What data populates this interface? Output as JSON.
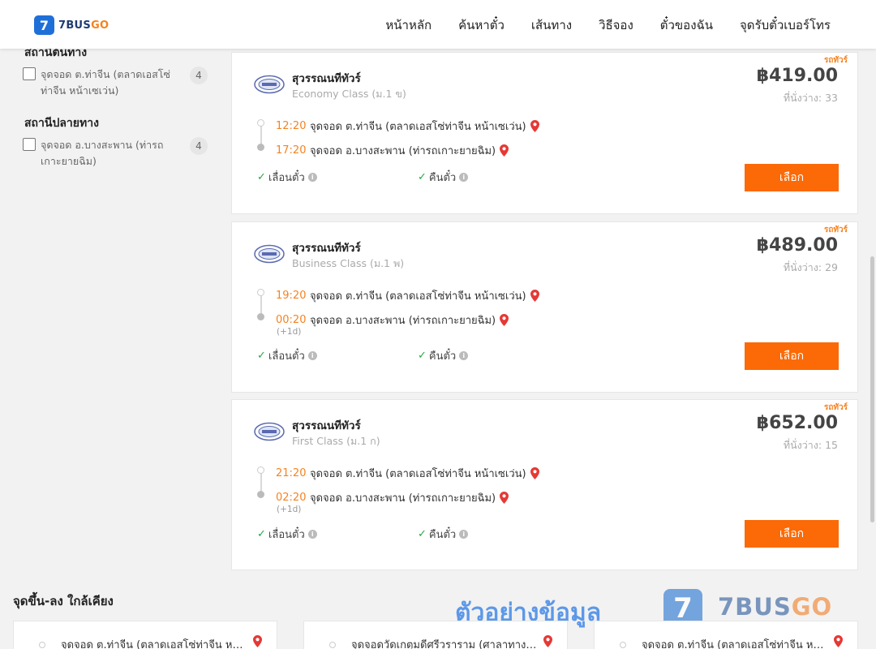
{
  "header": {
    "logo_mark": "7",
    "logo_text_a": "7BUS",
    "logo_text_b": "GO",
    "nav": [
      "หน้าหลัก",
      "ค้นหาตั๋ว",
      "เส้นทาง",
      "วิธีจอง",
      "ตั๋วของฉัน",
      "จุดรับตั๋วเบอร์โทร"
    ]
  },
  "filters": {
    "origin_title": "สถานีต้นทาง",
    "origin_item": {
      "label": "จุดจอด ต.ท่าจีน (ตลาดเอสโซ่ท่าจีน หน้าเซเว่น)",
      "count": "4"
    },
    "dest_title": "สถานีปลายทาง",
    "dest_item": {
      "label": "จุดจอด อ.บางสะพาน (ท่ารถเกาะยายฉิม)",
      "count": "4"
    }
  },
  "trips": [
    {
      "tag": "รถทัวร์",
      "operator": "สุวรรณนทีทัวร์",
      "class": "Economy Class (ม.1 ข)",
      "price": "฿419.00",
      "seats": "ที่นั่งว่าง: 33",
      "depart_time": "12:20",
      "depart_stop": "จุดจอด ต.ท่าจีน (ตลาดเอสโซ่ท่าจีน หน้าเซเว่น)",
      "arrive_time": "17:20",
      "arrive_stop": "จุดจอด อ.บางสะพาน (ท่ารถเกาะยายฉิม)",
      "next_day": "",
      "feature_1": "เลื่อนตั๋ว",
      "feature_2": "คืนตั๋ว",
      "button": "เลือก"
    },
    {
      "tag": "รถทัวร์",
      "operator": "สุวรรณนทีทัวร์",
      "class": "Business Class (ม.1 พ)",
      "price": "฿489.00",
      "seats": "ที่นั่งว่าง: 29",
      "depart_time": "19:20",
      "depart_stop": "จุดจอด ต.ท่าจีน (ตลาดเอสโซ่ท่าจีน หน้าเซเว่น)",
      "arrive_time": "00:20",
      "arrive_stop": "จุดจอด อ.บางสะพาน (ท่ารถเกาะยายฉิม)",
      "next_day": "(+1d)",
      "feature_1": "เลื่อนตั๋ว",
      "feature_2": "คืนตั๋ว",
      "button": "เลือก"
    },
    {
      "tag": "รถทัวร์",
      "operator": "สุวรรณนทีทัวร์",
      "class": "First Class (ม.1 ก)",
      "price": "฿652.00",
      "seats": "ที่นั่งว่าง: 15",
      "depart_time": "21:20",
      "depart_stop": "จุดจอด ต.ท่าจีน (ตลาดเอสโซ่ท่าจีน หน้าเซเว่น)",
      "arrive_time": "02:20",
      "arrive_stop": "จุดจอด อ.บางสะพาน (ท่ารถเกาะยายฉิม)",
      "next_day": "(+1d)",
      "feature_1": "เลื่อนตั๋ว",
      "feature_2": "คืนตั๋ว",
      "button": "เลือก"
    }
  ],
  "nearby": {
    "title": "จุดขึ้น-ลง ใกล้เคียง",
    "items": [
      "จุดจอด ต.ท่าจีน (ตลาดเอสโซ่ท่าจีน หน้าเซเว่น)",
      "จุดจอดวัดเกตุมดีศรีวราราม (ศาลาทางเข้าวัด)",
      "จุดจอด ต.ท่าจีน (ตลาดเอสโซ่ท่าจีน หน้าเซเว่น)"
    ]
  },
  "watermark": {
    "text": "ตัวอย่างข้อมูล",
    "logo_mark": "7",
    "brand_a": "7BUS",
    "brand_b": "GO"
  },
  "colors": {
    "accent_orange": "#fb6a06",
    "time_orange": "#f5821f",
    "check_green": "#27a844",
    "pin_red": "#e53935",
    "brand_blue": "#1f6fd9"
  }
}
